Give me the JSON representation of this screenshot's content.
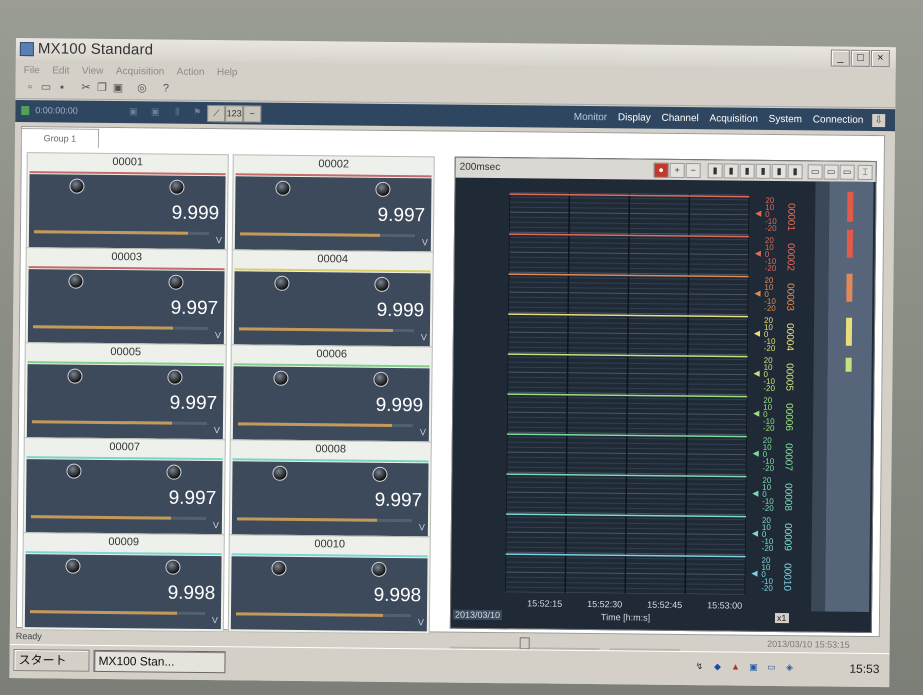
{
  "window": {
    "title": "MX100 Standard",
    "minimize": "_",
    "maximize": "□",
    "close": "×"
  },
  "menu": [
    "File",
    "Edit",
    "View",
    "Acquisition",
    "Action",
    "Help"
  ],
  "toolbar_icons": [
    "new-file-icon",
    "open-folder-icon",
    "save-icon",
    "cut-icon",
    "copy-icon",
    "paste-icon",
    "print-preview-icon",
    "help-icon"
  ],
  "navbar": {
    "elapsed_time": "0:00:00:00",
    "links": [
      "Monitor",
      "Display",
      "Channel",
      "Acquisition",
      "System",
      "Connection"
    ],
    "download_icon": "download-icon",
    "meter_icon_label": "123",
    "chart_icon_label": "~"
  },
  "tab": {
    "label": "Group 1"
  },
  "meters": [
    {
      "name": "00001",
      "value": "9.999",
      "fill": 0.88,
      "stripe": "#c46a68"
    },
    {
      "name": "00002",
      "value": "9.997",
      "fill": 0.8,
      "stripe": "#c46a68"
    },
    {
      "name": "00003",
      "value": "9.997",
      "fill": 0.8,
      "stripe": "#c46a68"
    },
    {
      "name": "00004",
      "value": "9.999",
      "fill": 0.88,
      "stripe": "#d9d06a"
    },
    {
      "name": "00005",
      "value": "9.997",
      "fill": 0.8,
      "stripe": "#7fcf86"
    },
    {
      "name": "00006",
      "value": "9.999",
      "fill": 0.88,
      "stripe": "#7fcf86"
    },
    {
      "name": "00007",
      "value": "9.997",
      "fill": 0.8,
      "stripe": "#7ad6c0"
    },
    {
      "name": "00008",
      "value": "9.997",
      "fill": 0.8,
      "stripe": "#7ad6c0"
    },
    {
      "name": "00009",
      "value": "9.998",
      "fill": 0.84,
      "stripe": "#7ad6d4"
    },
    {
      "name": "00010",
      "value": "9.998",
      "fill": 0.84,
      "stripe": "#7ad6d4"
    }
  ],
  "trend": {
    "rate": "200msec",
    "date": "2013/03/10",
    "time_axis_label": "Time [h:m:s]",
    "zoom_label": "x1",
    "tool_icons": [
      "record-icon",
      "zoom-in-icon",
      "zoom-out-icon",
      "bar-icon",
      "bar2-icon",
      "bar3-icon",
      "bar4-icon",
      "bar5-icon",
      "bar6-icon",
      "layout1-icon",
      "layout2-icon",
      "layout3-icon",
      "settings-icon"
    ]
  },
  "chart_data": {
    "type": "line",
    "x_ticks": [
      "15:52:15",
      "15:52:30",
      "15:52:45",
      "15:53:00"
    ],
    "series": [
      {
        "name": "00001",
        "color": "#e26a5a",
        "values": [
          10,
          10,
          10,
          10,
          10
        ]
      },
      {
        "name": "00002",
        "color": "#e26a5a",
        "values": [
          10,
          10,
          10,
          10,
          10
        ]
      },
      {
        "name": "00003",
        "color": "#e08a5a",
        "values": [
          10,
          10,
          10,
          10,
          10
        ]
      },
      {
        "name": "00004",
        "color": "#e7df7e",
        "values": [
          10,
          10,
          10,
          10,
          10
        ]
      },
      {
        "name": "00005",
        "color": "#c8e07e",
        "values": [
          10,
          10,
          10,
          10,
          10
        ]
      },
      {
        "name": "00006",
        "color": "#9be07e",
        "values": [
          10,
          10,
          10,
          10,
          10
        ]
      },
      {
        "name": "00007",
        "color": "#7edc9a",
        "values": [
          10,
          10,
          10,
          10,
          10
        ]
      },
      {
        "name": "00008",
        "color": "#7ed8b4",
        "values": [
          10,
          10,
          10,
          10,
          10
        ]
      },
      {
        "name": "00009",
        "color": "#7edad0",
        "values": [
          10,
          10,
          10,
          10,
          10
        ]
      },
      {
        "name": "00010",
        "color": "#7ed2e0",
        "values": [
          10,
          10,
          10,
          10,
          10
        ]
      }
    ],
    "scale_ticks": [
      "20",
      "10",
      "0",
      "-10",
      "-20"
    ],
    "ylim": [
      -20,
      20
    ]
  },
  "status": {
    "ready": "Ready",
    "timestamp": "2013/03/10 15:53:15"
  },
  "taskbar": {
    "start_label": "スタート",
    "task_label": "MX100 Stan...",
    "clock": "15:53"
  }
}
